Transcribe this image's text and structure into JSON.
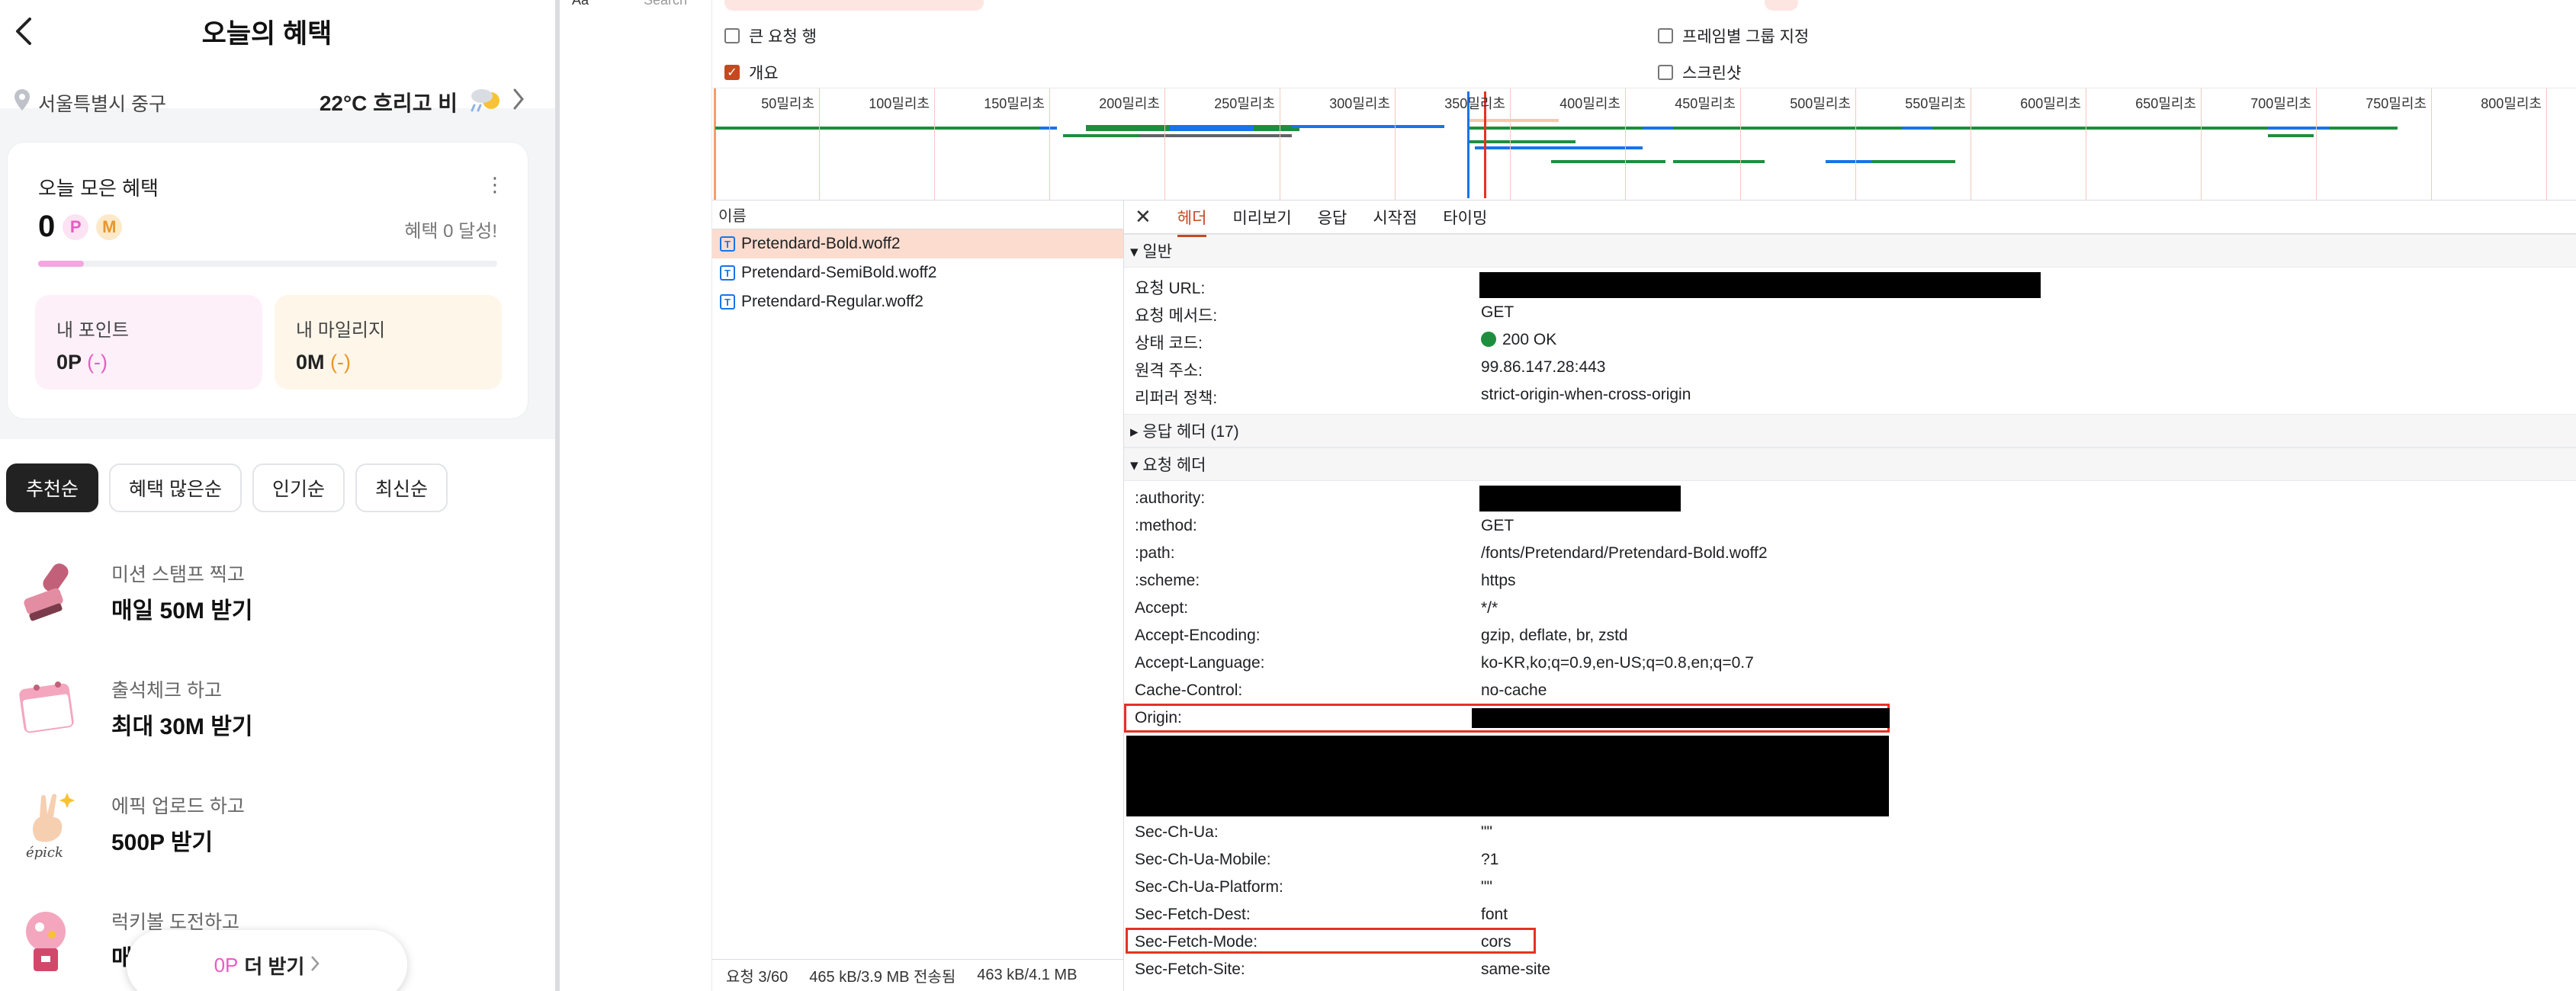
{
  "app": {
    "title": "오늘의 혜택",
    "location": "서울특별시 중구",
    "weather": "22°C 흐리고 비",
    "card": {
      "title": "오늘 모은 혜택",
      "points": "0",
      "chip_p": "P",
      "chip_m": "M",
      "achievement": "혜택 0 달성!",
      "progress_fraction": 0.1,
      "my_points_label": "내 포인트",
      "my_points_value": "0P",
      "my_points_delta": "(-)",
      "my_mileage_label": "내 마일리지",
      "my_mileage_value": "0M",
      "my_mileage_delta": "(-)"
    },
    "sorts": [
      "추천순",
      "혜택 많은순",
      "인기순",
      "최신순"
    ],
    "missions": [
      {
        "sub": "미션 스탬프 찍고",
        "main": "매일 50M 받기",
        "icon": "stamp-icon"
      },
      {
        "sub": "출석체크 하고",
        "main": "최대 30M 받기",
        "icon": "calendar-icon"
      },
      {
        "sub": "에픽 업로드 하고",
        "main": "500P 받기",
        "icon": "epick-hand-icon"
      },
      {
        "sub": "럭키볼 도전하고",
        "main": "매",
        "icon": "gumball-icon"
      }
    ],
    "more_button": {
      "op": "0P",
      "label": "더 받기"
    }
  },
  "devtools": {
    "toolbar": {
      "aa": "Aa",
      "search_placeholder": "Search"
    },
    "checks": [
      {
        "label": "큰 요청 행",
        "checked": false
      },
      {
        "label": "개요",
        "checked": true
      },
      {
        "label": "프레임별 그룹 지정",
        "checked": false
      },
      {
        "label": "스크린샷",
        "checked": false
      }
    ],
    "ticks": [
      "50밀리초",
      "100밀리초",
      "150밀리초",
      "200밀리초",
      "250밀리초",
      "300밀리초",
      "350밀리초",
      "400밀리초",
      "450밀리초",
      "500밀리초",
      "550밀리초",
      "600밀리초",
      "650밀리초",
      "700밀리초",
      "750밀리초",
      "800밀리초"
    ],
    "name_header": "이름",
    "files": [
      "Pretendard-Bold.woff2",
      "Pretendard-SemiBold.woff2",
      "Pretendard-Regular.woff2"
    ],
    "status": {
      "requests": "요청 3/60",
      "transferred": "465 kB/3.9 MB 전송됨",
      "resources": "463 kB/4.1 MB"
    },
    "tabs": [
      "헤더",
      "미리보기",
      "응답",
      "시작점",
      "타이밍"
    ],
    "general": {
      "title": "▾ 일반",
      "rows": [
        {
          "k": "요청 URL:",
          "v": ""
        },
        {
          "k": "요청 메서드:",
          "v": "GET"
        },
        {
          "k": "상태 코드:",
          "v": "200 OK"
        },
        {
          "k": "원격 주소:",
          "v": "99.86.147.28:443"
        },
        {
          "k": "리퍼러 정책:",
          "v": "strict-origin-when-cross-origin"
        }
      ]
    },
    "response_headers_title": "▸ 응답 헤더 (17)",
    "request_headers": {
      "title": "▾ 요청 헤더",
      "rows": [
        {
          "k": ":authority:",
          "v": ""
        },
        {
          "k": ":method:",
          "v": "GET"
        },
        {
          "k": ":path:",
          "v": "/fonts/Pretendard/Pretendard-Bold.woff2"
        },
        {
          "k": ":scheme:",
          "v": "https"
        },
        {
          "k": "Accept:",
          "v": "*/*"
        },
        {
          "k": "Accept-Encoding:",
          "v": "gzip, deflate, br, zstd"
        },
        {
          "k": "Accept-Language:",
          "v": "ko-KR,ko;q=0.9,en-US;q=0.8,en;q=0.7"
        },
        {
          "k": "Cache-Control:",
          "v": "no-cache"
        },
        {
          "k": "Origin:",
          "v": ""
        }
      ],
      "rows_after": [
        {
          "k": "Sec-Ch-Ua:",
          "v": "\"\""
        },
        {
          "k": "Sec-Ch-Ua-Mobile:",
          "v": "?1"
        },
        {
          "k": "Sec-Ch-Ua-Platform:",
          "v": "\"\""
        },
        {
          "k": "Sec-Fetch-Dest:",
          "v": "font"
        },
        {
          "k": "Sec-Fetch-Mode:",
          "v": "cors"
        },
        {
          "k": "Sec-Fetch-Site:",
          "v": "same-site"
        }
      ]
    }
  }
}
